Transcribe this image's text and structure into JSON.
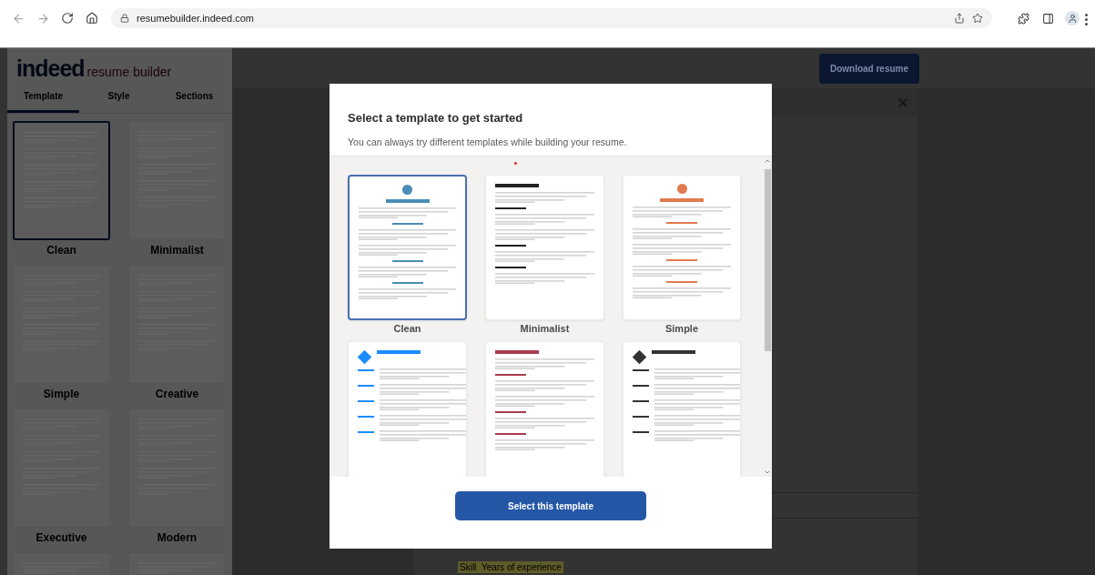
{
  "browser": {
    "url": "resumebuilder.indeed.com"
  },
  "sidebar": {
    "logo": {
      "brand": "indeed",
      "product": "resume builder"
    },
    "tabs": [
      {
        "label": "Template",
        "selected": true
      },
      {
        "label": "Style",
        "selected": false
      },
      {
        "label": "Sections",
        "selected": false
      }
    ],
    "templates": [
      {
        "name": "Clean",
        "selected": true
      },
      {
        "name": "Minimalist",
        "selected": false
      },
      {
        "name": "Simple",
        "selected": false
      },
      {
        "name": "Creative",
        "selected": false
      },
      {
        "name": "Executive",
        "selected": false
      },
      {
        "name": "Modern",
        "selected": false
      }
    ]
  },
  "header": {
    "download_button": "Download resume"
  },
  "document": {
    "skill_chip": {
      "skill": "Skill",
      "years": "Years of experience"
    }
  },
  "modal": {
    "title": "Select a template to get started",
    "subtitle": "You can always try different templates while building your resume.",
    "templates": [
      {
        "name": "Clean",
        "selected": true,
        "color": "#4a8db5",
        "kind": "centered"
      },
      {
        "name": "Minimalist",
        "selected": false,
        "color": "#222222",
        "kind": "left"
      },
      {
        "name": "Simple",
        "selected": false,
        "color": "#e07a4f",
        "kind": "centered"
      },
      {
        "selected": false,
        "color": "#1a8cff",
        "kind": "columns"
      },
      {
        "selected": false,
        "color": "#a83b4f",
        "kind": "left"
      },
      {
        "selected": false,
        "color": "#333333",
        "kind": "columns"
      }
    ],
    "select_button": "Select this template"
  }
}
